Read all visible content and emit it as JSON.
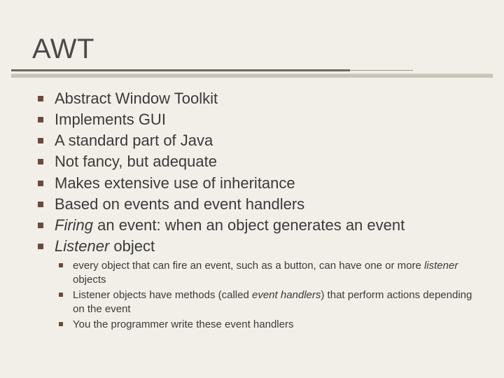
{
  "title": "AWT",
  "bullets": [
    {
      "text": "Abstract Window Toolkit"
    },
    {
      "text": "Implements GUI"
    },
    {
      "text": "A standard part of Java"
    },
    {
      "text": "Not fancy, but adequate"
    },
    {
      "text": "Makes extensive use of inheritance"
    },
    {
      "text": "Based on events and event handlers"
    },
    {
      "prefix_italic": "Firing",
      "rest": " an event: when an object generates an event"
    },
    {
      "prefix_italic": "Listener",
      "rest": " object",
      "sub": [
        {
          "a": "every object that can fire an event, such as a button, can have one or more ",
          "i": "listener",
          "b": " objects"
        },
        {
          "a": "Listener objects have methods (called ",
          "i": "event handlers",
          "b": ") that perform actions depending on the event"
        },
        {
          "a": "You the programmer write these event handlers",
          "i": "",
          "b": ""
        }
      ]
    }
  ]
}
